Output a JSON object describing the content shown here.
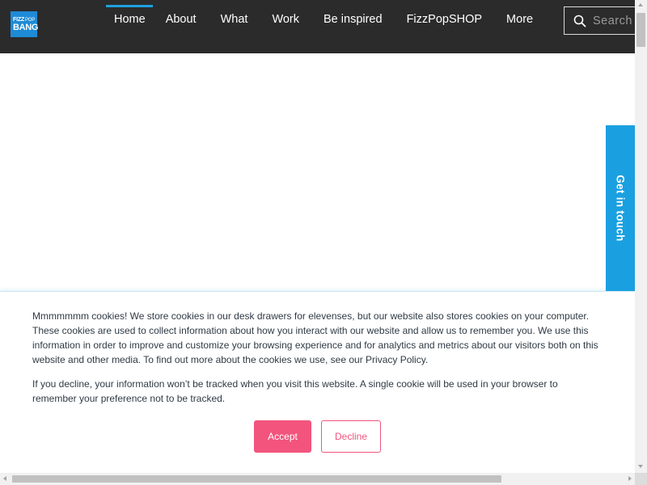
{
  "header": {
    "logo": {
      "line1": "FIZZ",
      "line1_small": "POP",
      "line2": "BANG"
    },
    "nav": [
      {
        "label": "Home",
        "active": true
      },
      {
        "label": "About"
      },
      {
        "label": "What"
      },
      {
        "label": "Work"
      },
      {
        "label": "Be inspired"
      },
      {
        "label": "FizzPopSHOP"
      },
      {
        "label": "More"
      }
    ],
    "search": {
      "placeholder": "Search",
      "icon": "search-icon"
    }
  },
  "touch_tab": {
    "label": "Get in touch"
  },
  "cookie_banner": {
    "paragraph1": "Mmmmmmm cookies! We store cookies in our desk drawers for elevenses, but our website also stores cookies on your computer. These cookies are used to collect information about how you interact with our website and allow us to remember you. We use this information in order to improve and customize your browsing experience and for analytics and metrics about our visitors both on this website and other media. To find out more about the cookies we use, see our Privacy Policy.",
    "paragraph2": "If you decline, your information won’t be tracked when you visit this website. A single cookie will be used in your browser to remember your preference not to be tracked.",
    "accept_label": "Accept",
    "decline_label": "Decline"
  },
  "colors": {
    "header_bg": "#2b2b2b",
    "accent_blue": "#1aa0e0",
    "button_pink": "#f2547d"
  }
}
